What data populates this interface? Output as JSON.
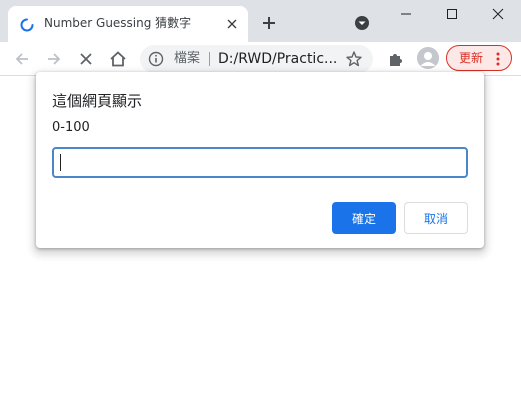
{
  "tab": {
    "title": "Number Guessing 猜數字",
    "icons": {
      "status": "loading-spinner-icon",
      "close": "close-icon"
    }
  },
  "tabstrip": {
    "new_tab_icon": "plus-icon",
    "tab_search_icon": "tab-search-icon",
    "window_controls": [
      "minimize-icon",
      "maximize-icon",
      "close-window-icon"
    ]
  },
  "toolbar": {
    "back_icon": "arrow-left-icon",
    "forward_icon": "arrow-right-icon",
    "stop_icon": "stop-loading-icon",
    "home_icon": "home-icon",
    "extensions_icon": "puzzle-icon",
    "profile_icon": "avatar-icon",
    "update_label": "更新",
    "menu_icon": "kebab-menu-icon"
  },
  "omnibox": {
    "info_icon": "info-icon",
    "scheme_label": "檔案",
    "url": "D:/RWD/Practic...",
    "bookmark_icon": "star-icon"
  },
  "dialog": {
    "title": "這個網頁顯示",
    "message": "0-100",
    "input_value": "",
    "ok_label": "確定",
    "cancel_label": "取消"
  },
  "colors": {
    "accent": "#1a73e8",
    "tabstrip_bg": "#dee1e6",
    "update_red": "#d93025",
    "input_border": "#4a86c8"
  }
}
